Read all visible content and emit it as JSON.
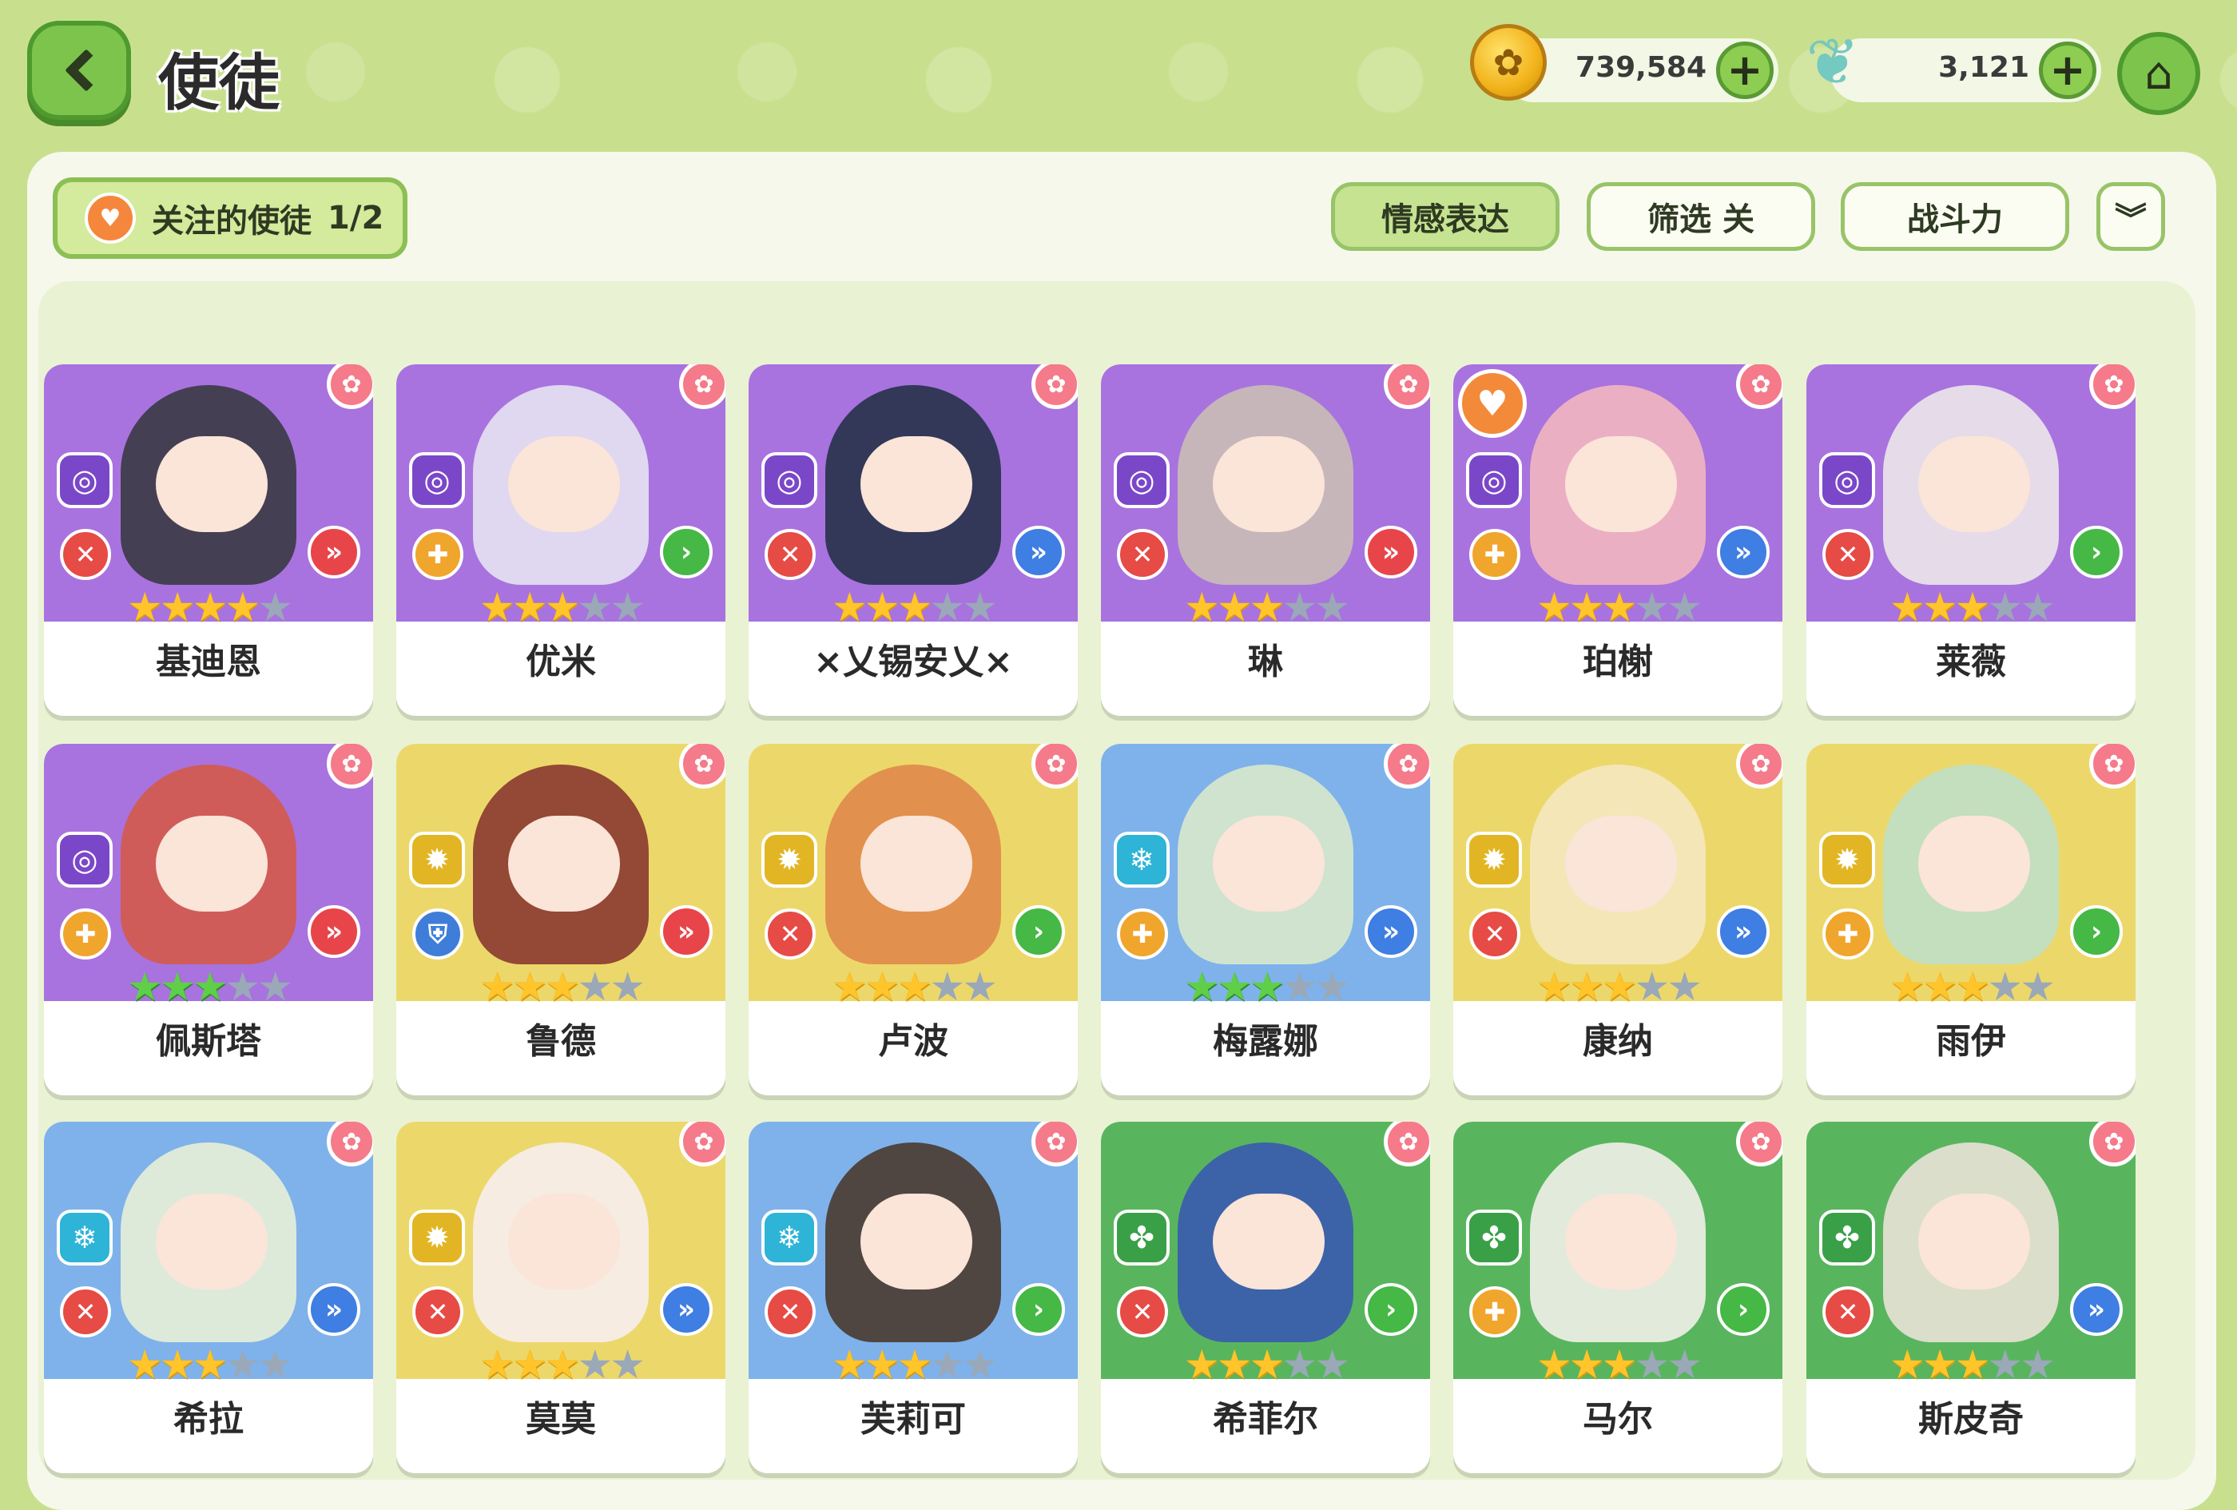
{
  "header": {
    "title": "使徒",
    "back_icon": "back-chevron-icon",
    "home_icon": "home-icon"
  },
  "currency": [
    {
      "icon": "gold-coin-icon",
      "value": "739,584"
    },
    {
      "icon": "crystal-leaf-icon",
      "value": "3,121"
    }
  ],
  "toolbar": {
    "follow_label": "关注的使徒",
    "follow_count": "1/2",
    "emotion_label": "情感表达",
    "filter_label": "筛选 关",
    "power_label": "战斗力",
    "expand_icon": "double-chevron-down-icon"
  },
  "colors": {
    "purple": "#a873df",
    "yellow": "#ecd86a",
    "blue": "#7fb2ea",
    "green": "#58b55e",
    "role_red": "#e64b45",
    "role_orange": "#f0a52d",
    "role_blue": "#3f7ed8",
    "elem_purple": "#7b47c9",
    "elem_yellow": "#e2b524",
    "elem_cyan": "#2db4d6",
    "elem_green": "#3aa048",
    "arrow_red": "#e8454b",
    "arrow_blue": "#3f7ee2",
    "arrow_green": "#45b845"
  },
  "apostles": [
    {
      "name": "基迪恩",
      "bg": "purple",
      "element": "spiral",
      "role": "sword",
      "arrow": "red",
      "stars": 4,
      "star_color": "gold",
      "favorite": false
    },
    {
      "name": "优米",
      "bg": "purple",
      "element": "spiral",
      "role": "cross",
      "arrow": "green",
      "stars": 3,
      "star_color": "gold",
      "favorite": false
    },
    {
      "name": "×乂锡安乂×",
      "bg": "purple",
      "element": "spiral",
      "role": "sword",
      "arrow": "blue",
      "stars": 3,
      "star_color": "gold",
      "favorite": false
    },
    {
      "name": "琳",
      "bg": "purple",
      "element": "spiral",
      "role": "sword",
      "arrow": "red",
      "stars": 3,
      "star_color": "gold",
      "favorite": false
    },
    {
      "name": "珀榭",
      "bg": "purple",
      "element": "spiral",
      "role": "cross",
      "arrow": "blue",
      "stars": 3,
      "star_color": "gold",
      "favorite": true
    },
    {
      "name": "莱薇",
      "bg": "purple",
      "element": "spiral",
      "role": "sword",
      "arrow": "green",
      "stars": 3,
      "star_color": "gold",
      "favorite": false
    },
    {
      "name": "佩斯塔",
      "bg": "purple",
      "element": "spiral",
      "role": "cross",
      "arrow": "red",
      "stars": 3,
      "star_color": "green",
      "favorite": false
    },
    {
      "name": "鲁德",
      "bg": "yellow",
      "element": "sun",
      "role": "shield",
      "arrow": "red",
      "stars": 3,
      "star_color": "gold",
      "favorite": false
    },
    {
      "name": "卢波",
      "bg": "yellow",
      "element": "sun",
      "role": "sword",
      "arrow": "green",
      "stars": 3,
      "star_color": "gold",
      "favorite": false
    },
    {
      "name": "梅露娜",
      "bg": "blue",
      "element": "snow",
      "role": "cross",
      "arrow": "blue",
      "stars": 3,
      "star_color": "green",
      "favorite": false
    },
    {
      "name": "康纳",
      "bg": "yellow",
      "element": "sun",
      "role": "sword",
      "arrow": "blue",
      "stars": 3,
      "star_color": "gold",
      "favorite": false
    },
    {
      "name": "雨伊",
      "bg": "yellow",
      "element": "sun",
      "role": "cross",
      "arrow": "green",
      "stars": 3,
      "star_color": "gold",
      "favorite": false
    },
    {
      "name": "希拉",
      "bg": "blue",
      "element": "snow",
      "role": "sword",
      "arrow": "blue",
      "stars": 3,
      "star_color": "gold",
      "favorite": false
    },
    {
      "name": "莫莫",
      "bg": "yellow",
      "element": "sun",
      "role": "sword",
      "arrow": "blue",
      "stars": 3,
      "star_color": "gold",
      "favorite": false
    },
    {
      "name": "芙莉可",
      "bg": "blue",
      "element": "snow",
      "role": "sword",
      "arrow": "green",
      "stars": 3,
      "star_color": "gold",
      "favorite": false
    },
    {
      "name": "希菲尔",
      "bg": "green",
      "element": "clover",
      "role": "sword",
      "arrow": "green",
      "stars": 3,
      "star_color": "gold",
      "favorite": false
    },
    {
      "name": "马尔",
      "bg": "green",
      "element": "clover",
      "role": "cross",
      "arrow": "green",
      "stars": 3,
      "star_color": "gold",
      "favorite": false
    },
    {
      "name": "斯皮奇",
      "bg": "green",
      "element": "clover",
      "role": "sword",
      "arrow": "blue",
      "stars": 3,
      "star_color": "gold",
      "favorite": false
    }
  ]
}
